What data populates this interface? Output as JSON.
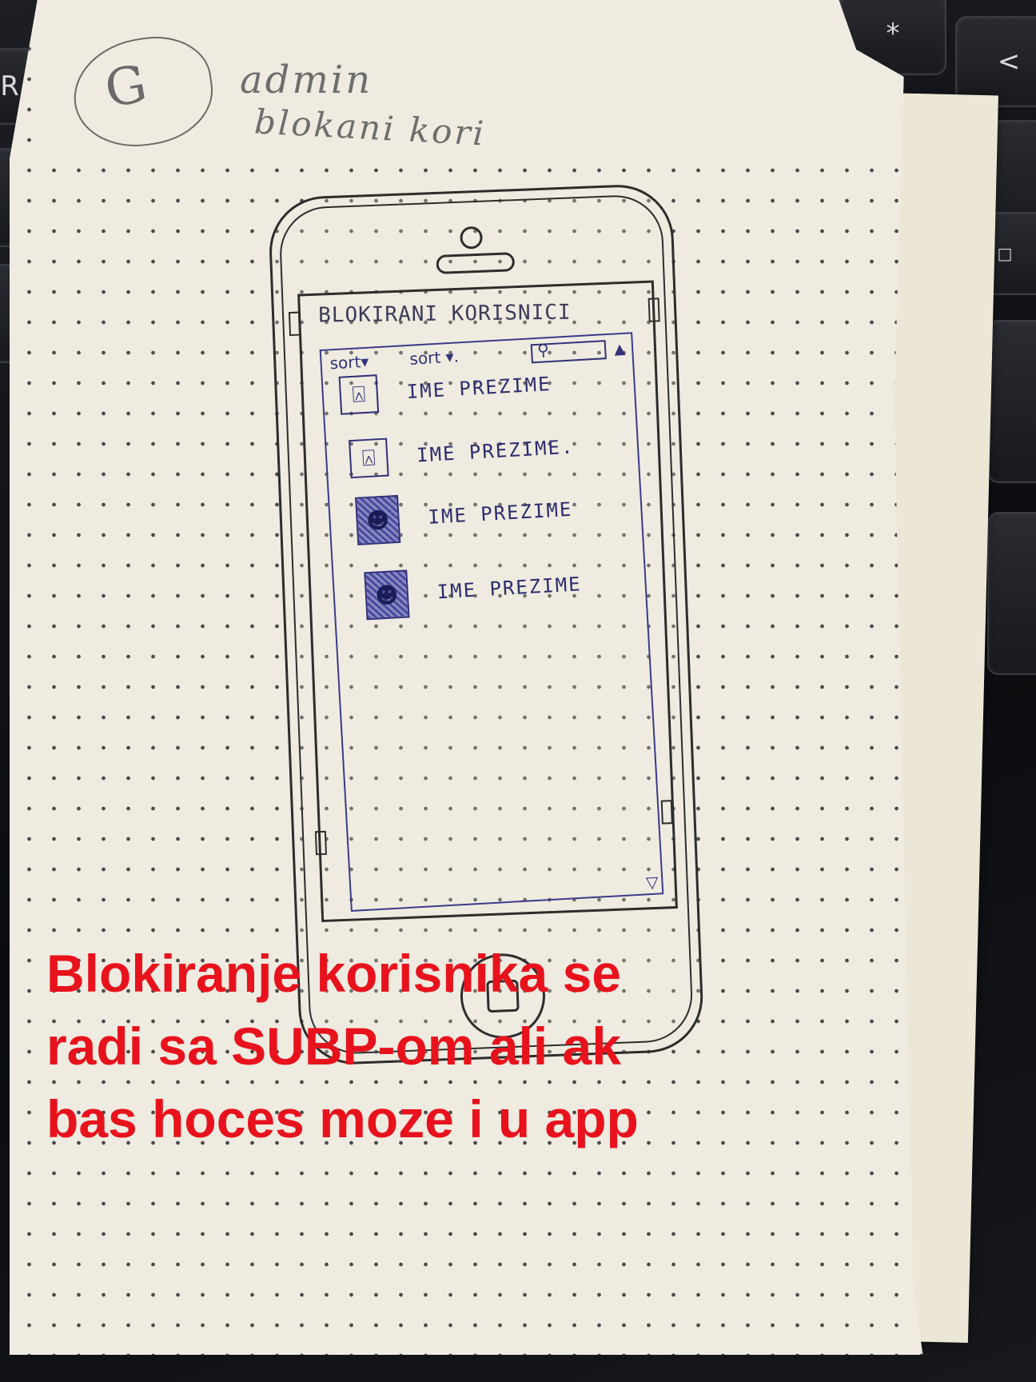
{
  "sketch": {
    "header": {
      "logo_letter": "G",
      "role_label": "admin",
      "subtitle": "blokani kori"
    },
    "screen": {
      "title": "BLOKIRANI KORISNICI",
      "sort_bar": {
        "sort_primary": "sort▾",
        "sort_secondary": "sort ▾.",
        "search_icon": "search-icon",
        "scroll_up_icon": "scroll-up-arrow-icon",
        "scroll_down_icon": "scroll-down-arrow-icon"
      },
      "users": [
        {
          "name": "IME PREZIME",
          "avatar": "outline"
        },
        {
          "name": "IME PREZIME.",
          "avatar": "outline"
        },
        {
          "name": "IME PREZIME",
          "avatar": "filled"
        },
        {
          "name": "IME PREZIME",
          "avatar": "filled"
        }
      ]
    }
  },
  "caption": {
    "lines": [
      "Blokiranje korisnika se",
      "radi sa SUBP-om ali ak",
      "bas hoces moze i u app"
    ],
    "color": "#e8121d"
  },
  "keyboard_keys": [
    "R",
    "(",
    ")",
    "=",
    "?",
    "*",
    "<",
    "□"
  ]
}
